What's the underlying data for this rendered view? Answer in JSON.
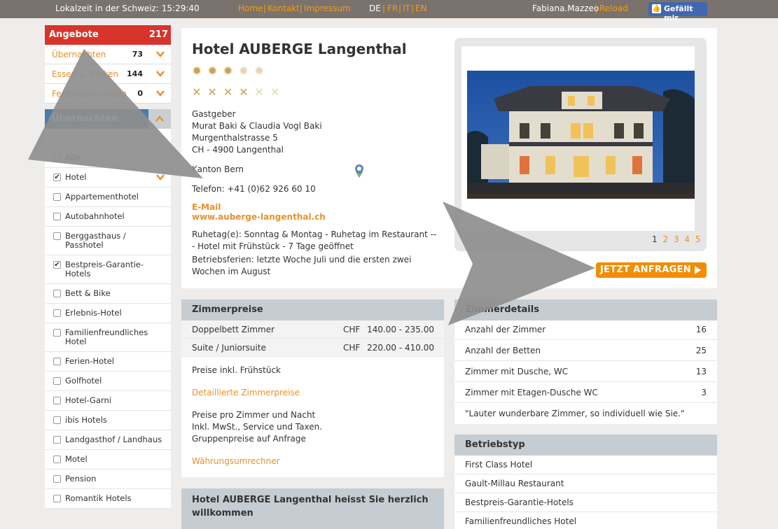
{
  "topbar": {
    "localtime": "Lokalzeit in der Schweiz: 15:29:40",
    "nav": [
      "Home",
      "Kontakt",
      "Impressum"
    ],
    "langs": [
      "DE",
      "FR",
      "IT",
      "EN"
    ],
    "user": "Fabiana.Mazzeo",
    "reload": "Reload",
    "fb_label": "Gefällt mir",
    "sep": "|"
  },
  "sidebar": {
    "angebote_title": "Angebote",
    "angebote_count": "217",
    "angebote_rows": [
      {
        "label": "Übernachten",
        "count": "73"
      },
      {
        "label": "Essen & Trinken",
        "count": "144"
      },
      {
        "label": "Ferienwohnungen",
        "count": "0"
      }
    ],
    "uebernachten_title": "Übernachten",
    "checkboxes": [
      {
        "label": "Alle",
        "checked": false
      },
      {
        "label": "Hotel",
        "checked": true
      },
      {
        "label": "Appartementhotel",
        "checked": false
      },
      {
        "label": "Autobahnhotel",
        "checked": false
      },
      {
        "label": "Berggasthaus / Passhotel",
        "checked": false
      },
      {
        "label": "Bestpreis-Garantie-Hotels",
        "checked": true
      },
      {
        "label": "Bett & Bike",
        "checked": false
      },
      {
        "label": "Erlebnis-Hotel",
        "checked": false
      },
      {
        "label": "Familienfreundliches Hotel",
        "checked": false
      },
      {
        "label": "Ferien-Hotel",
        "checked": false
      },
      {
        "label": "Golfhotel",
        "checked": false
      },
      {
        "label": "Hotel-Garni",
        "checked": false
      },
      {
        "label": "ibis Hotels",
        "checked": false
      },
      {
        "label": "Landgasthof / Landhaus",
        "checked": false
      },
      {
        "label": "Motel",
        "checked": false
      },
      {
        "label": "Pension",
        "checked": false
      },
      {
        "label": "Romantik Hotels",
        "checked": false
      }
    ]
  },
  "hotel": {
    "name": "Hotel AUBERGE Langenthal",
    "stars": 3,
    "stars_max": 5,
    "forks": 4,
    "forks_max": 6,
    "host_label": "Gastgeber",
    "host_names": "Murat Baki & Claudia Vogl Baki",
    "street": "Murgenthalstrasse 5",
    "city": "CH - 4900 Langenthal",
    "canton": "Kanton Bern",
    "phone": "Telefon: +41 (0)62 926 60 10",
    "email_label": "E-Mail",
    "website": "www.auberge-langenthal.ch",
    "ruhetag": "Ruhetag(e): Sonntag & Montag - Ruhetag im Restaurant --- Hotel mit Frühstück - 7 Tage geöffnet",
    "betriebsferien": "Betriebsferien: letzte Woche Juli und die ersten zwei Wochen im August"
  },
  "gallery": {
    "pages": [
      "1",
      "2",
      "3",
      "4",
      "5"
    ],
    "current_page": "1"
  },
  "cta": {
    "label": "JETZT ANFRAGEN"
  },
  "zimmerpreise": {
    "title": "Zimmerpreise",
    "rows": [
      {
        "name": "Doppelbett Zimmer",
        "currency": "CHF",
        "price": "140.00 - 235.00"
      },
      {
        "name": "Suite / Juniorsuite",
        "currency": "CHF",
        "price": "220.00 - 410.00"
      }
    ],
    "note_breakfast": "Preise inkl. Frühstück",
    "detail_link": "Detaillierte Zimmerpreise",
    "note_lines": [
      "Preise pro Zimmer und Nacht",
      "Inkl. MwSt., Service und Taxen.",
      "Gruppenpreise auf Anfrage"
    ],
    "currency_link": "Währungsumrechner"
  },
  "welcome": {
    "title": "Hotel AUBERGE Langenthal heisst Sie herzlich willkommen"
  },
  "zimmerdetails": {
    "title": "Zimmerdetails",
    "rows": [
      {
        "label": "Anzahl der Zimmer",
        "value": "16"
      },
      {
        "label": "Anzahl der Betten",
        "value": "25"
      },
      {
        "label": "Zimmer mit Dusche, WC",
        "value": "13"
      },
      {
        "label": "Zimmer mit Etagen-Dusche WC",
        "value": "3"
      }
    ],
    "quote": "\"Lauter wunderbare Zimmer, so individuell wie Sie.\""
  },
  "betriebstyp": {
    "title": "Betriebstyp",
    "items": [
      "First Class Hotel",
      "Gault-Millau Restaurant",
      "Bestpreis-Garantie-Hotels",
      "Familienfreundliches Hotel"
    ]
  },
  "colors": {
    "accent": "#e8912a",
    "red": "#d8342b",
    "blue": "#4a7ca8",
    "cta": "#f28c00"
  }
}
